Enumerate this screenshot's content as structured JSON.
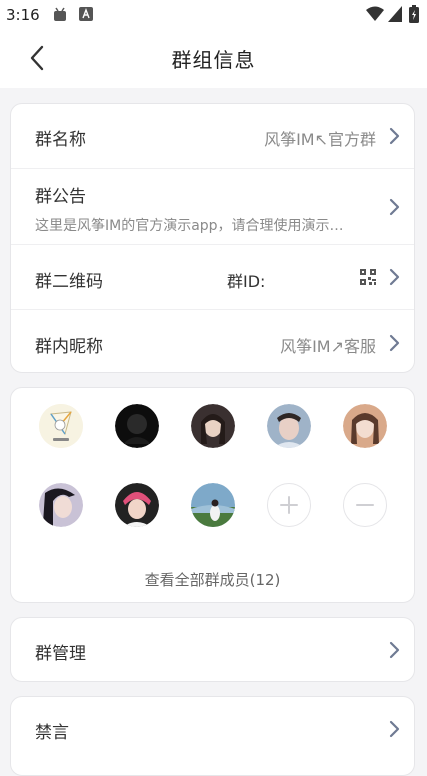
{
  "status_bar": {
    "time": "3:16"
  },
  "header": {
    "title": "群组信息"
  },
  "group_info": {
    "name_label": "群名称",
    "name_value": "风筝IM↖官方群",
    "notice_label": "群公告",
    "notice_text": "这里是风筝IM的官方演示app，请合理使用演示…",
    "qrcode_label": "群二维码",
    "group_id_label": "群ID:",
    "nickname_label": "群内昵称",
    "nickname_value": "风筝IM↗客服"
  },
  "members": {
    "avatars": [
      "member-1",
      "member-2",
      "member-3",
      "member-4",
      "member-5",
      "member-6",
      "member-7",
      "member-8"
    ],
    "add_icon": "plus-icon",
    "remove_icon": "minus-icon",
    "view_all_label": "查看全部群成员(12)"
  },
  "admin": {
    "manage_label": "群管理"
  },
  "mute": {
    "label": "禁言"
  },
  "colors": {
    "background": "#f4f4f6",
    "card": "#ffffff",
    "text": "#333333",
    "muted": "#8a8a8a",
    "chevron": "#6f7a93"
  }
}
